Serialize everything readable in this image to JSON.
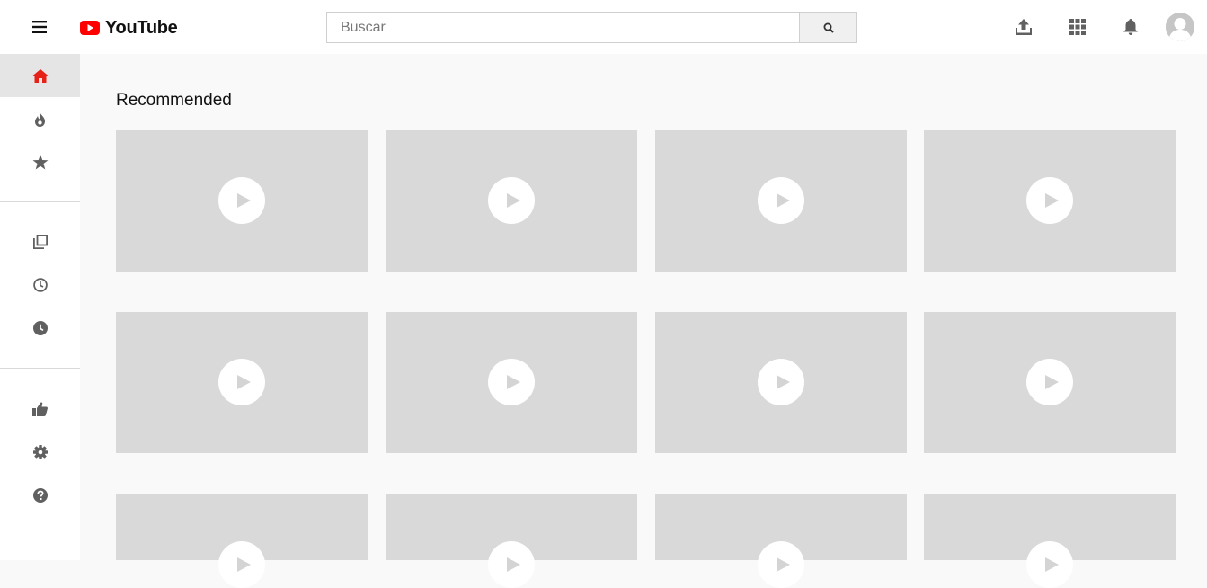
{
  "header": {
    "logo_text": "YouTube",
    "search_placeholder": "Buscar",
    "search_value": "",
    "icons": [
      "menu-icon",
      "youtube-logo-icon",
      "search-icon",
      "upload-icon",
      "apps-grid-icon",
      "bell-icon",
      "avatar-icon"
    ]
  },
  "sidebar": {
    "items": [
      {
        "name": "home",
        "icon": "home-icon",
        "active": true
      },
      {
        "name": "trending",
        "icon": "fire-icon",
        "active": false
      },
      {
        "name": "subscriptions",
        "icon": "star-icon",
        "active": false
      },
      {
        "name": "library",
        "icon": "library-icon",
        "active": false
      },
      {
        "name": "history",
        "icon": "history-icon",
        "active": false
      },
      {
        "name": "watch-later",
        "icon": "clock-icon",
        "active": false
      },
      {
        "name": "liked",
        "icon": "thumbs-up-icon",
        "active": false
      },
      {
        "name": "settings",
        "icon": "gear-icon",
        "active": false
      },
      {
        "name": "help",
        "icon": "help-icon",
        "active": false
      }
    ]
  },
  "main": {
    "section_title": "Recommended",
    "video_count_visible": 12
  },
  "colors": {
    "brand_red": "#ff0000",
    "active_icon": "#e62117",
    "icon_gray": "#606060",
    "thumb_bg": "#d9d9d9",
    "page_bg": "#f9f9f9"
  }
}
